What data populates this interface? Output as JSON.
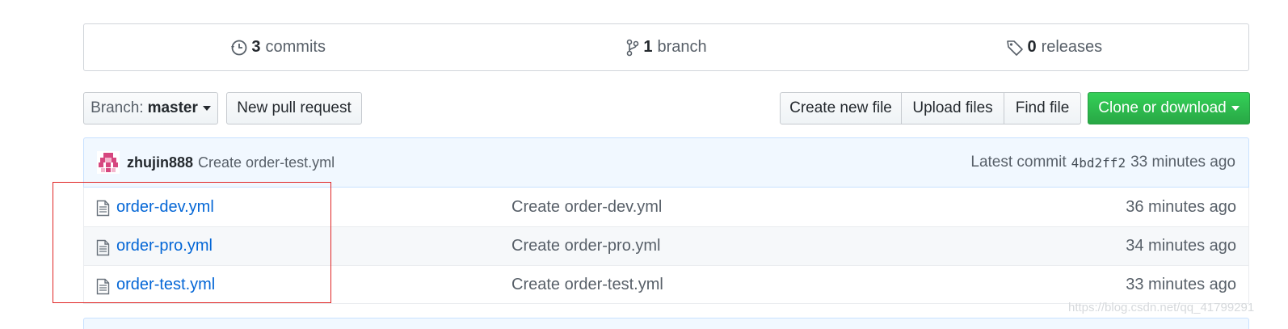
{
  "summary": {
    "commits_count": "3",
    "commits_label": "commits",
    "branch_count": "1",
    "branch_label": "branch",
    "releases_count": "0",
    "releases_label": "releases"
  },
  "toolbar": {
    "branch_label": "Branch:",
    "branch_value": "master",
    "new_pull_request": "New pull request",
    "create_new_file": "Create new file",
    "upload_files": "Upload files",
    "find_file": "Find file",
    "clone_or_download": "Clone or download"
  },
  "latest_commit": {
    "author": "zhujin888",
    "message": "Create order-test.yml",
    "prefix": "Latest commit",
    "sha": "4bd2ff2",
    "age": "33 minutes ago"
  },
  "files": [
    {
      "name": "order-dev.yml",
      "message": "Create order-dev.yml",
      "age": "36 minutes ago"
    },
    {
      "name": "order-pro.yml",
      "message": "Create order-pro.yml",
      "age": "34 minutes ago"
    },
    {
      "name": "order-test.yml",
      "message": "Create order-test.yml",
      "age": "33 minutes ago"
    }
  ],
  "watermark": "https://blog.csdn.net/qq_41799291",
  "colors": {
    "link": "#0366d6",
    "clone_button": "#2ea44f",
    "highlight_box": "#e02424",
    "commit_bar_bg": "#f1f8ff"
  },
  "icons": {
    "commits": "history-icon",
    "branch": "git-branch-icon",
    "releases": "tag-icon",
    "file": "file-icon"
  }
}
